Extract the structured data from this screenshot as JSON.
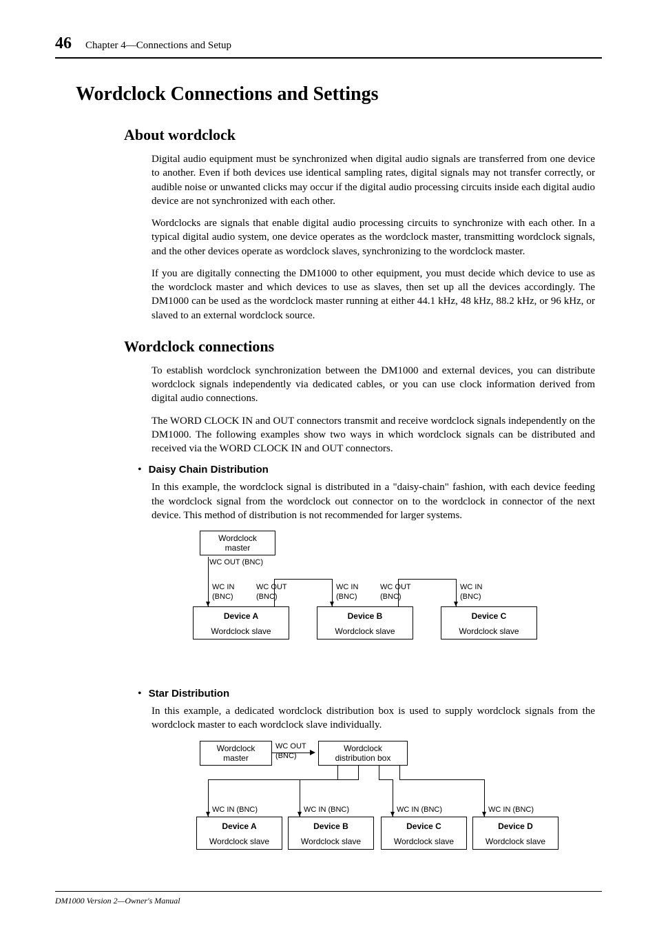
{
  "header": {
    "page_number": "46",
    "chapter": "Chapter 4—Connections and Setup"
  },
  "h1": "Wordclock Connections and Settings",
  "s1": {
    "title": "About wordclock",
    "p1": "Digital audio equipment must be synchronized when digital audio signals are transferred from one device to another. Even if both devices use identical sampling rates, digital signals may not transfer correctly, or audible noise or unwanted clicks may occur if the digital audio processing circuits inside each digital audio device are not synchronized with each other.",
    "p2": "Wordclocks are signals that enable digital audio processing circuits to synchronize with each other. In a typical digital audio system, one device operates as the wordclock master, transmitting wordclock signals, and the other devices operate as wordclock slaves, synchronizing to the wordclock master.",
    "p3": "If you are digitally connecting the DM1000 to other equipment, you must decide which device to use as the wordclock master and which devices to use as slaves, then set up all the devices accordingly. The DM1000 can be used as the wordclock master running at either 44.1 kHz, 48 kHz, 88.2 kHz, or 96 kHz, or slaved to an external wordclock source."
  },
  "s2": {
    "title": "Wordclock connections",
    "p1": "To establish wordclock synchronization between the DM1000 and external devices, you can distribute wordclock signals independently via dedicated cables, or you can use clock information derived from digital audio connections.",
    "p2": "The WORD CLOCK IN and OUT connectors transmit and receive wordclock signals independently on the DM1000. The following examples show two ways in which wordclock signals can be distributed and received via the WORD CLOCK IN and OUT connectors.",
    "b1": {
      "title": "Daisy Chain Distribution",
      "p": "In this example, the wordclock signal is distributed in a \"daisy-chain\" fashion, with each device feeding the wordclock signal from the wordclock out connector on to the wordclock in connector of the next device. This method of distribution is not recommended for larger systems."
    },
    "b2": {
      "title": "Star Distribution",
      "p": "In this example, a dedicated wordclock distribution box is used to supply wordclock signals from the wordclock master to each wordclock slave individually."
    }
  },
  "d1": {
    "master_l1": "Wordclock",
    "master_l2": "master",
    "wc_out_bnc": "WC OUT (BNC)",
    "wc_in": "WC IN",
    "wc_out": "WC OUT",
    "bnc": "(BNC)",
    "devA": "Device A",
    "devB": "Device B",
    "devC": "Device C",
    "slave": "Wordclock slave"
  },
  "d2": {
    "master_l1": "Wordclock",
    "master_l2": "master",
    "wc_out": "WC OUT",
    "bnc": "(BNC)",
    "dist_l1": "Wordclock",
    "dist_l2": "distribution box",
    "wc_in_bnc": "WC IN (BNC)",
    "devA": "Device A",
    "devB": "Device B",
    "devC": "Device C",
    "devD": "Device D",
    "slave": "Wordclock slave"
  },
  "footer": "DM1000 Version 2—Owner's Manual"
}
